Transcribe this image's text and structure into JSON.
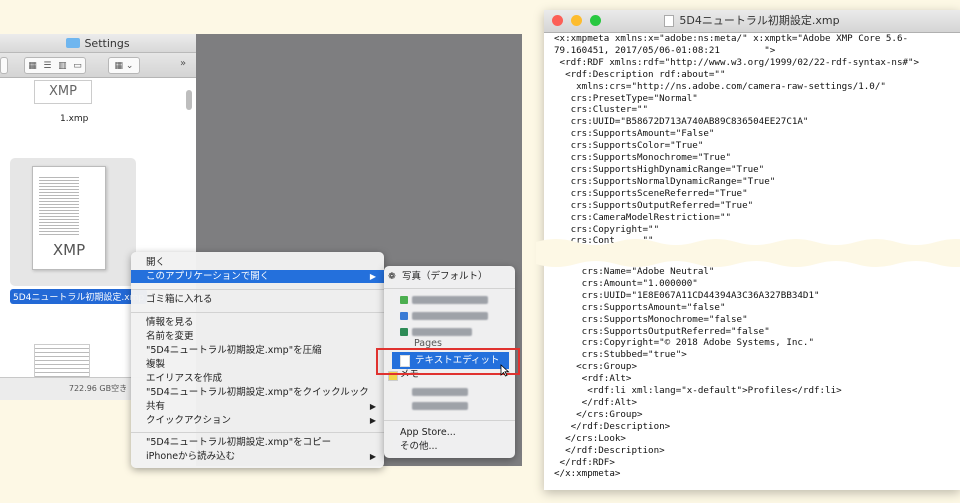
{
  "finder": {
    "title": "Settings",
    "files": [
      {
        "name": "1.xmp",
        "thumb_text": "XMP"
      },
      {
        "name": "5D4ニュートラル初期設定.xmp",
        "thumb_text": "XMP"
      }
    ],
    "status": "722.96 GB空き"
  },
  "context_menu": {
    "items": [
      {
        "label": "開く"
      },
      {
        "label": "このアプリケーションで開く",
        "submenu": true,
        "highlighted": true
      },
      {
        "label": "ゴミ箱に入れる"
      },
      {
        "label": "情報を見る"
      },
      {
        "label": "名前を変更"
      },
      {
        "label": "\"5D4ニュートラル初期設定.xmp\"を圧縮"
      },
      {
        "label": "複製"
      },
      {
        "label": "エイリアスを作成"
      },
      {
        "label": "\"5D4ニュートラル初期設定.xmp\"をクイックルック"
      },
      {
        "label": "共有",
        "submenu": true
      },
      {
        "label": "クイックアクション",
        "submenu": true
      },
      {
        "label": "\"5D4ニュートラル初期設定.xmp\"をコピー"
      },
      {
        "label": "iPhoneから読み込む",
        "submenu": true
      }
    ]
  },
  "open_with_submenu": {
    "default_app": "写真（デフォルト）",
    "partial_app": "Pages",
    "textedit": "テキストエディット",
    "memo": "メモ",
    "app_store": "App Store...",
    "other": "その他..."
  },
  "editor": {
    "title": "5D4ニュートラル初期設定.xmp",
    "lines_top": [
      "<x:xmpmeta xmlns:x=\"adobe:ns:meta/\" x:xmptk=\"Adobe XMP Core 5.6-",
      "79.160451, 2017/05/06-01:08:21        \">",
      " <rdf:RDF xmlns:rdf=\"http://www.w3.org/1999/02/22-rdf-syntax-ns#\">",
      "  <rdf:Description rdf:about=\"\"",
      "    xmlns:crs=\"http://ns.adobe.com/camera-raw-settings/1.0/\"",
      "   crs:PresetType=\"Normal\"",
      "   crs:Cluster=\"\"",
      "   crs:UUID=\"B58672D713A740AB89C836504EE27C1A\"",
      "   crs:SupportsAmount=\"False\"",
      "   crs:SupportsColor=\"True\"",
      "   crs:SupportsMonochrome=\"True\"",
      "   crs:SupportsHighDynamicRange=\"True\"",
      "   crs:SupportsNormalDynamicRange=\"True\"",
      "   crs:SupportsSceneReferred=\"True\"",
      "   crs:SupportsOutputReferred=\"True\"",
      "   crs:CameraModelRestriction=\"\"",
      "   crs:Copyright=\"\"",
      "   crs:Cont     \"\""
    ],
    "lines_bottom": [
      "     crs:Name=\"Adobe Neutral\"",
      "     crs:Amount=\"1.000000\"",
      "     crs:UUID=\"1E8E067A11CD44394A3C36A327BB34D1\"",
      "     crs:SupportsAmount=\"false\"",
      "     crs:SupportsMonochrome=\"false\"",
      "     crs:SupportsOutputReferred=\"false\"",
      "     crs:Copyright=\"© 2018 Adobe Systems, Inc.\"",
      "     crs:Stubbed=\"true\">",
      "    <crs:Group>",
      "     <rdf:Alt>",
      "      <rdf:li xml:lang=\"x-default\">Profiles</rdf:li>",
      "     </rdf:Alt>",
      "    </crs:Group>",
      "   </rdf:Description>",
      "  </crs:Look>",
      "  </rdf:Description>",
      " </rdf:RDF>",
      "</x:xmpmeta>"
    ]
  },
  "colors": {
    "selection": "#2470dc",
    "highlight_box": "#e0322f"
  }
}
